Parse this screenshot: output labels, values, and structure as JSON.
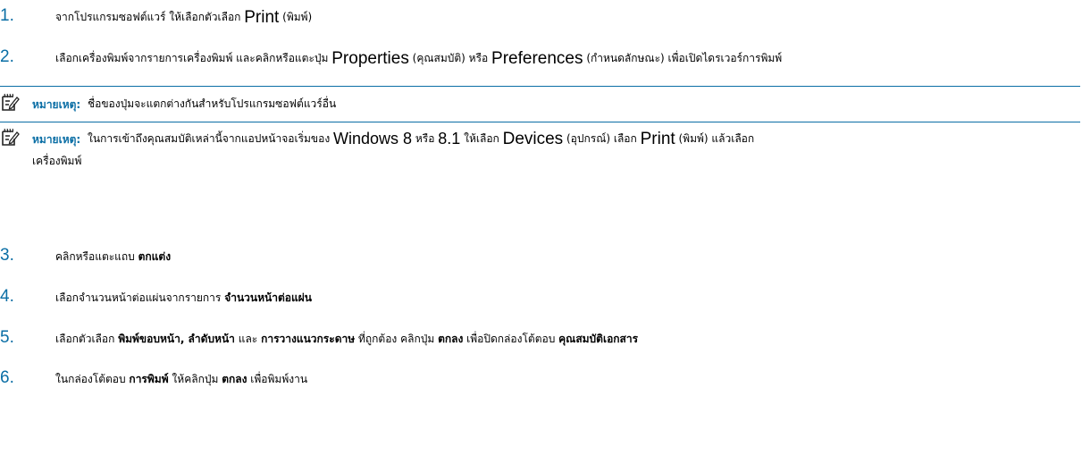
{
  "steps": [
    {
      "num": "1.",
      "a": "จากโปรแกรมซอฟต์แวร์ ให้เลือกตัวเลือก ",
      "b": "Print",
      "c": " (พิมพ์)"
    },
    {
      "num": "2.",
      "a": "เลือกเครื่องพิมพ์จากรายการเครื่องพิมพ์ และคลิกหรือแตะปุ่ม ",
      "b": "Properties",
      "c": " (คุณสมบัติ) หรือ ",
      "d": "Preferences",
      "e": " (กำหนดลักษณะ) เพื่อเปิดไดรเวอร์การพิมพ์"
    },
    {
      "num": "3.",
      "a": "คลิกหรือแตะแถบ ",
      "b": "ตกแต่ง"
    },
    {
      "num": "4.",
      "a": "เลือกจำนวนหน้าต่อแผ่นจากรายการ ",
      "b": "จำนวนหน้าต่อแผ่น"
    },
    {
      "num": "5.",
      "a": "เลือกตัวเลือก ",
      "b": "พิมพ์ขอบหน้า, ลำดับหน้า",
      "c": " และ ",
      "d": "การวางแนวกระดาษ",
      "e": " ที่ถูกต้อง คลิกปุ่ม ",
      "f": "ตกลง",
      "g": " เพื่อปิดกล่องโต้ตอบ ",
      "h": "คุณสมบัติเอกสาร"
    },
    {
      "num": "6.",
      "a": "ในกล่องโต้ตอบ ",
      "b": "การพิมพ์",
      "c": " ให้คลิกปุ่ม ",
      "d": "ตกลง",
      "e": " เพื่อพิมพ์งาน"
    }
  ],
  "notes": [
    {
      "label": "หมายเหตุ:",
      "text": "ชื่อของปุ่มจะแตกต่างกันสำหรับโปรแกรมซอฟต์แวร์อื่น"
    },
    {
      "label": "หมายเหตุ:",
      "a": "ในการเข้าถึงคุณสมบัติเหล่านี้จากแอปหน้าจอเริ่มของ ",
      "win": "Windows 8",
      "b": " หรือ ",
      "win2": "8.1",
      "c": " ให้เลือก ",
      "d": "Devices",
      "e": " (อุปกรณ์) เลือก ",
      "f": "Print",
      "g": " (พิมพ์) แล้วเลือก",
      "cont": "เครื่องพิมพ์"
    }
  ],
  "colors": {
    "accent": "#0a6ea5"
  },
  "icons": {
    "note": "note-pencil-icon"
  }
}
